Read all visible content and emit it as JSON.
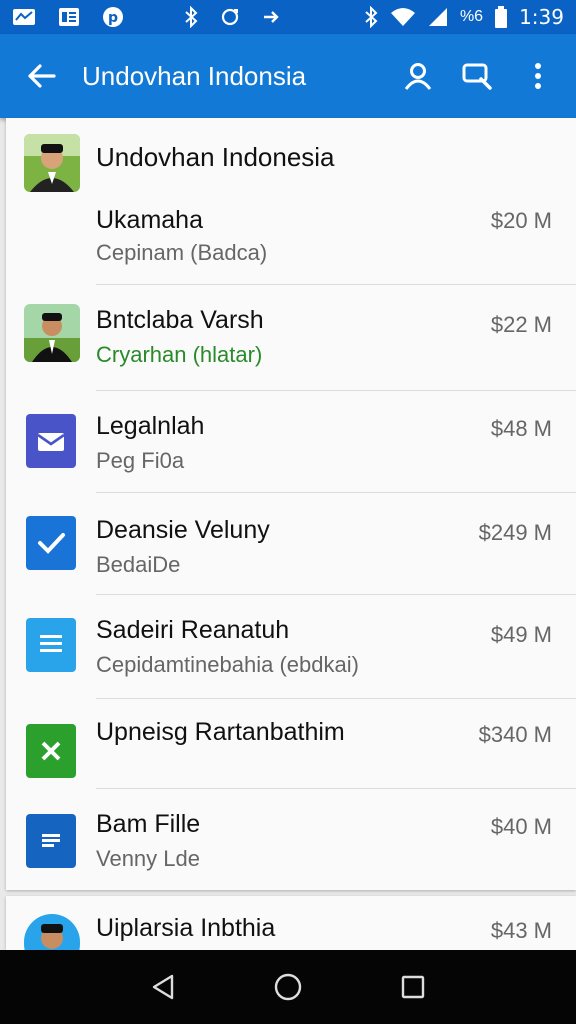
{
  "status_bar": {
    "time": "1:39",
    "signal_text": "%6"
  },
  "app_bar": {
    "title": "Undovhan Indonsia"
  },
  "card": {
    "header_title": "Undovhan Indonesia",
    "items": [
      {
        "title": "Ukamaha",
        "subtitle": "Cepinam (Badca)",
        "price": "$20 M",
        "icon": "person-photo"
      },
      {
        "title": "Bntclaba  Varsh",
        "subtitle": "Cryarhan (hlatar)",
        "price": "$22 M",
        "icon": "person-photo"
      },
      {
        "title": "Legalnlah",
        "subtitle": "Peg Fi0a",
        "price": "$48 M",
        "icon": "mail-doc-icon"
      },
      {
        "title": "Deansie Veluny",
        "subtitle": "BedaiDe",
        "price": "$249 M",
        "icon": "check-doc-icon"
      },
      {
        "title": "Sadeiri Reanatuh",
        "subtitle": "Cepidamtinebahia (ebdkai)",
        "price": "$49 M",
        "icon": "lines-doc-icon"
      },
      {
        "title": "Upneisg Rartanbathim",
        "subtitle": "",
        "price": "$340 M",
        "icon": "sheet-icon"
      },
      {
        "title": "Bam Fille",
        "subtitle": "Venny Lde",
        "price": "$40 M",
        "icon": "slides-icon"
      }
    ]
  },
  "peek_item": {
    "title": "Uiplarsia Inbthia",
    "price": "$43 M"
  },
  "colors": {
    "app_bar": "#1279d6",
    "status_bar": "#0a63c4",
    "nav_bar": "#050505"
  }
}
